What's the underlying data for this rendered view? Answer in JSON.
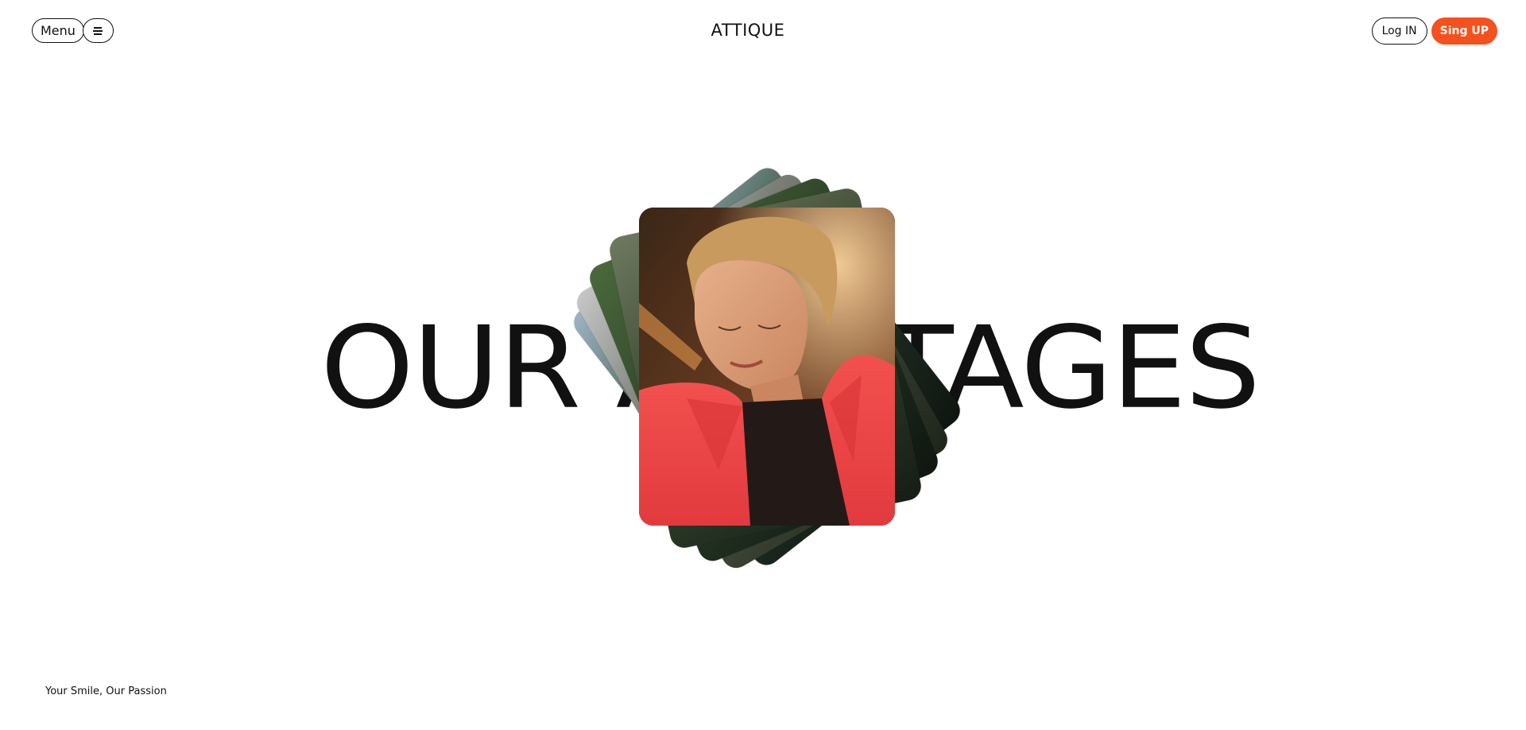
{
  "header": {
    "menu_label": "Menu",
    "menu_icon": "hamburger-icon",
    "brand": "ATTIQUE",
    "login_label": "Log IN",
    "signup_label": "Sing UP"
  },
  "hero": {
    "text_left": "OUR A",
    "text_right": "TAGES"
  },
  "footer": {
    "tagline": "Your Smile, Our Passion"
  },
  "colors": {
    "accent": "#f4511e",
    "text": "#111111",
    "background": "#ffffff"
  }
}
